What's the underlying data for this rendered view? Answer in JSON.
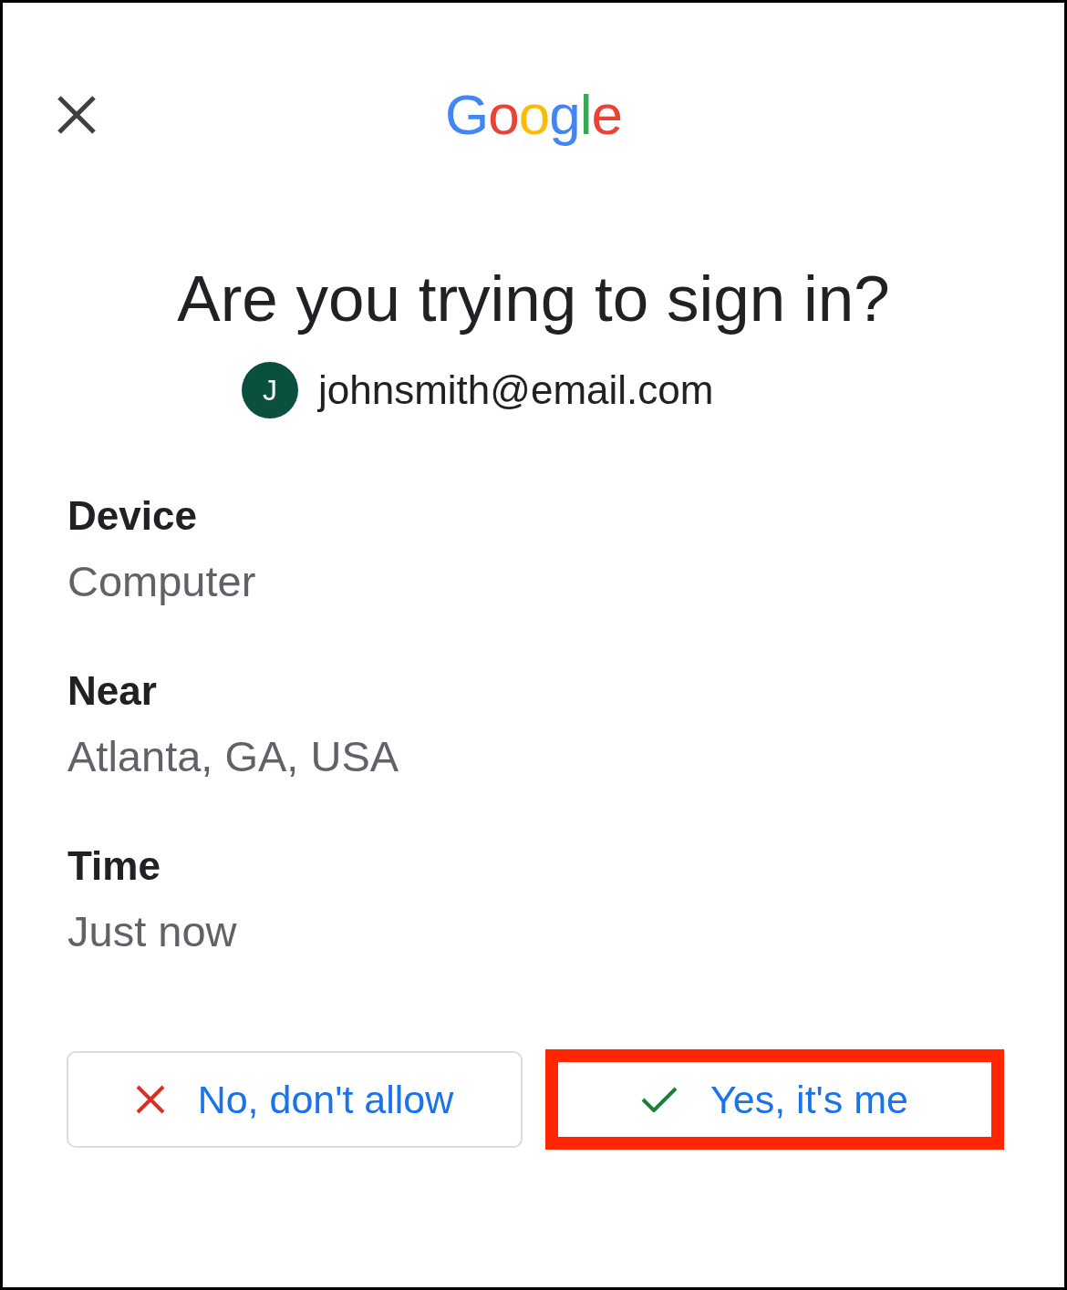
{
  "header": {
    "logo": "Google"
  },
  "title": "Are you trying to sign in?",
  "account": {
    "initial": "J",
    "email": "johnsmith@email.com"
  },
  "details": [
    {
      "label": "Device",
      "value": "Computer"
    },
    {
      "label": "Near",
      "value": "Atlanta, GA, USA"
    },
    {
      "label": "Time",
      "value": "Just now"
    }
  ],
  "buttons": [
    {
      "kind": "deny",
      "label": "No, don't allow",
      "highlighted": false
    },
    {
      "kind": "approve",
      "label": "Yes, it's me",
      "highlighted": true
    }
  ]
}
